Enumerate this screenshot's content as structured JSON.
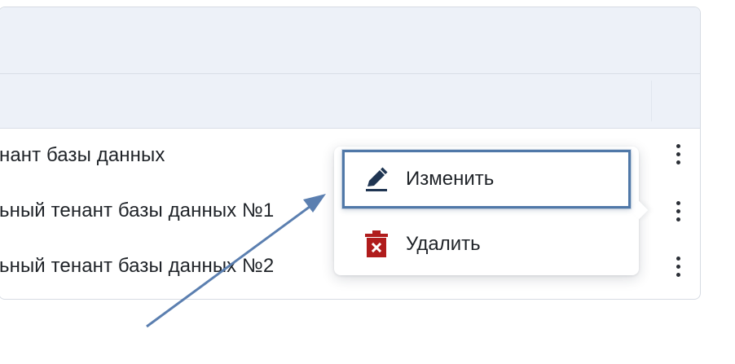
{
  "table": {
    "rows": [
      {
        "name": "нант базы данных"
      },
      {
        "name": "ьный тенант базы данных №1"
      },
      {
        "name": "ьный тенант базы данных №2"
      }
    ]
  },
  "context_menu": {
    "items": [
      {
        "label": "Изменить",
        "icon": "pencil-icon",
        "icon_color": "#1f3552"
      },
      {
        "label": "Удалить",
        "icon": "trash-icon",
        "icon_color": "#b01c1c"
      }
    ],
    "highlight_color": "#5078a8"
  },
  "annotation": {
    "arrow_color": "#5b7fb0"
  }
}
